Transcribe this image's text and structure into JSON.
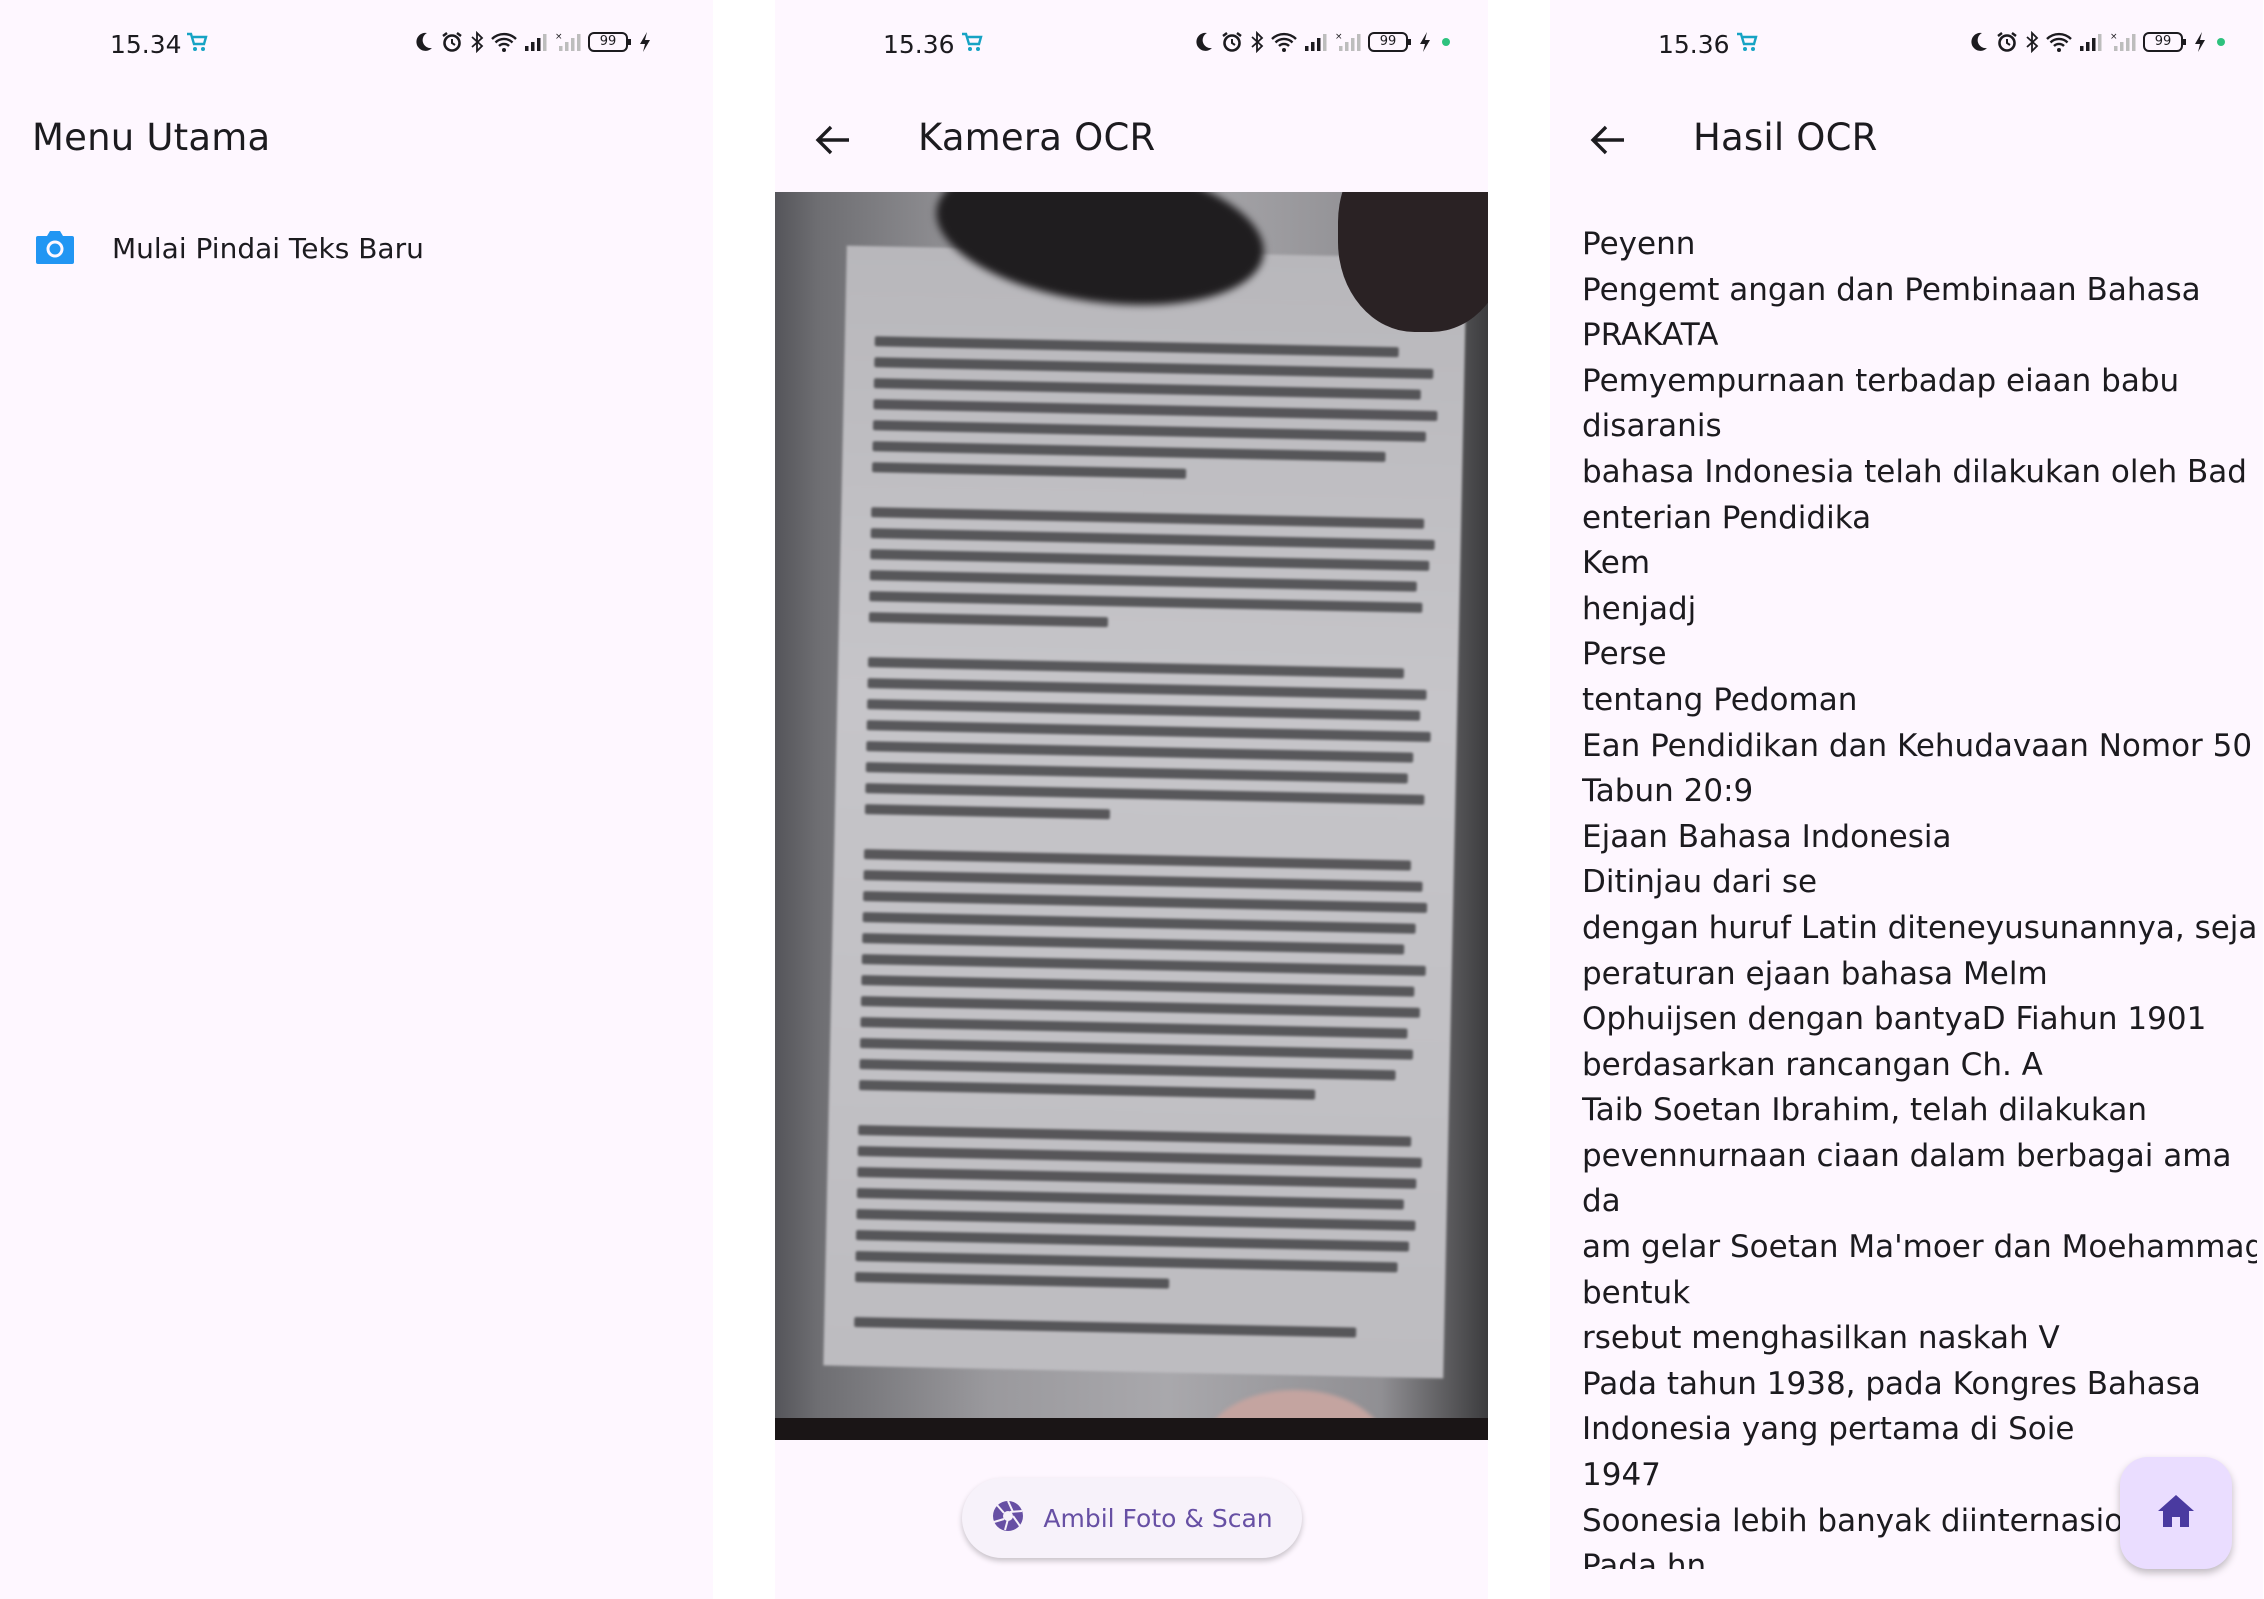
{
  "colors": {
    "background": "#fef7ff",
    "text": "#1c1b1f",
    "primary": "#6750a4",
    "fab_bg": "#eaddff",
    "menu_icon": "#2196f3"
  },
  "screens": {
    "menu": {
      "status": {
        "time": "15.34",
        "battery": "99"
      },
      "title": "Menu Utama",
      "items": [
        {
          "icon": "camera-icon",
          "label": "Mulai Pindai Teks Baru"
        }
      ]
    },
    "camera": {
      "status": {
        "time": "15.36",
        "battery": "99"
      },
      "title": "Kamera OCR",
      "capture_button": {
        "icon": "shutter-icon",
        "label": "Ambil Foto & Scan"
      }
    },
    "result": {
      "status": {
        "time": "15.36",
        "battery": "99"
      },
      "title": "Hasil OCR",
      "lines": [
        "Peyenn",
        "Pengemt angan dan Pembinaan Bahasa",
        "PRAKATA",
        "Pemyempurnaan terbadap eiaan babu",
        "disaranis",
        "bahasa Indonesia telah dilakukan oleh Bad",
        "enterian Pendidika",
        "Kem",
        "henjadj",
        "Perse",
        "tentang Pedoman",
        "Ean Pendidikan dan Kehudavaan Nomor 50",
        "Tabun 20:9",
        "Ejaan Bahasa Indonesia",
        "Ditinjau dari se",
        "dengan huruf Latin diteneyusunannya, sejak",
        "peraturan ejaan bahasa Melm",
        "Ophuijsen dengan bantyaD Fiahun 1901",
        "berdasarkan rancangan Ch. A",
        "Taib Soetan Ibrahim, telah dilakukan",
        "pevennurnaan ciaan dalam berbagai ama",
        "da",
        "am gelar Soetan Ma'moer dan Moehammag",
        "bentuk",
        "rsebut menghasilkan naskah V",
        "Pada tahun 1938, pada Kongres Bahasa",
        "Indonesia yang pertama di Soie",
        "1947",
        "Soonesia lebih banyak diinternasiona",
        "Pada hn"
      ],
      "fab_icon": "home-icon"
    }
  }
}
